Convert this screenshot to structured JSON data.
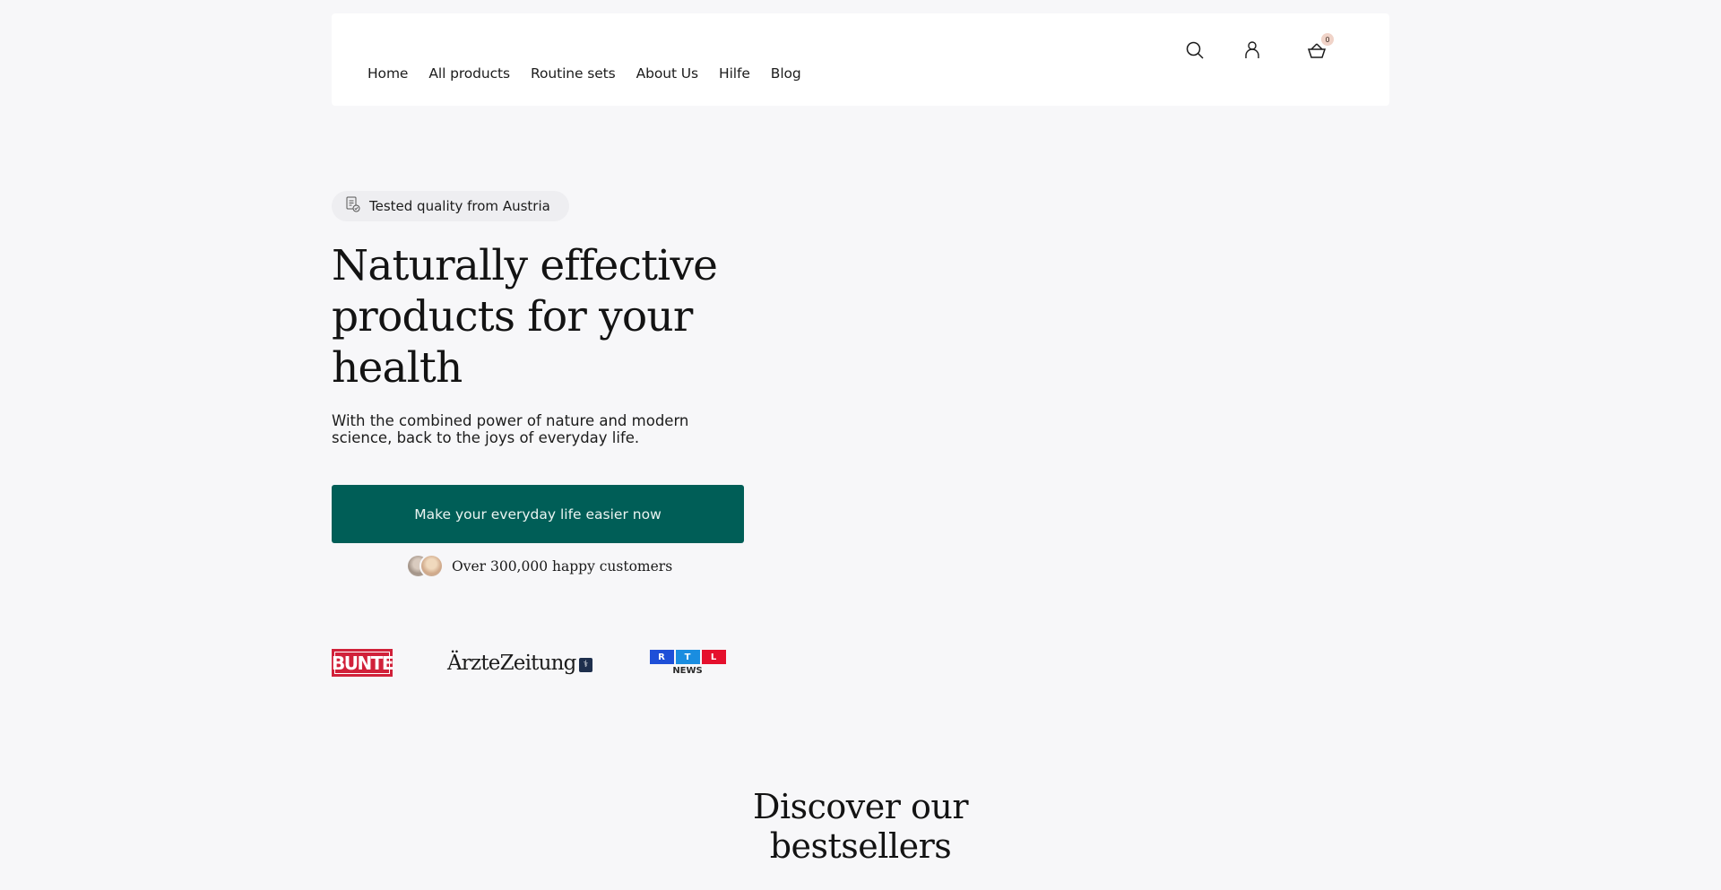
{
  "header": {
    "nav": [
      {
        "label": "Home"
      },
      {
        "label": "All products"
      },
      {
        "label": "Routine sets"
      },
      {
        "label": "About Us"
      },
      {
        "label": "Hilfe"
      },
      {
        "label": "Blog"
      }
    ],
    "icons": {
      "search": "search-icon",
      "account": "user-icon",
      "cart": "basket-icon"
    },
    "cart_count": "0"
  },
  "hero": {
    "badge_icon": "certificate-check-icon",
    "badge_text": "Tested quality from Austria",
    "title": "Naturally effective products for your health",
    "subtitle": "With the combined power of nature and modern science, back to the joys of everyday life.",
    "cta_label": "Make your everyday life easier now",
    "social_proof": "Over 300,000 happy customers"
  },
  "press_logos": {
    "bunte": "BUNTE",
    "aerzte": "ÄrzteZeitung",
    "rtl_letters": [
      "R",
      "T",
      "L"
    ],
    "rtl_news": "NEWS"
  },
  "colors": {
    "accent": "#005e57",
    "background": "#f7f7f9",
    "badge": "#f0d3c8",
    "bunte_red": "#d1213a",
    "rtl_blue1": "#1e4fd8",
    "rtl_blue2": "#1a8de0",
    "rtl_red": "#e5102d"
  },
  "bestsellers": {
    "title": "Discover our bestsellers"
  }
}
